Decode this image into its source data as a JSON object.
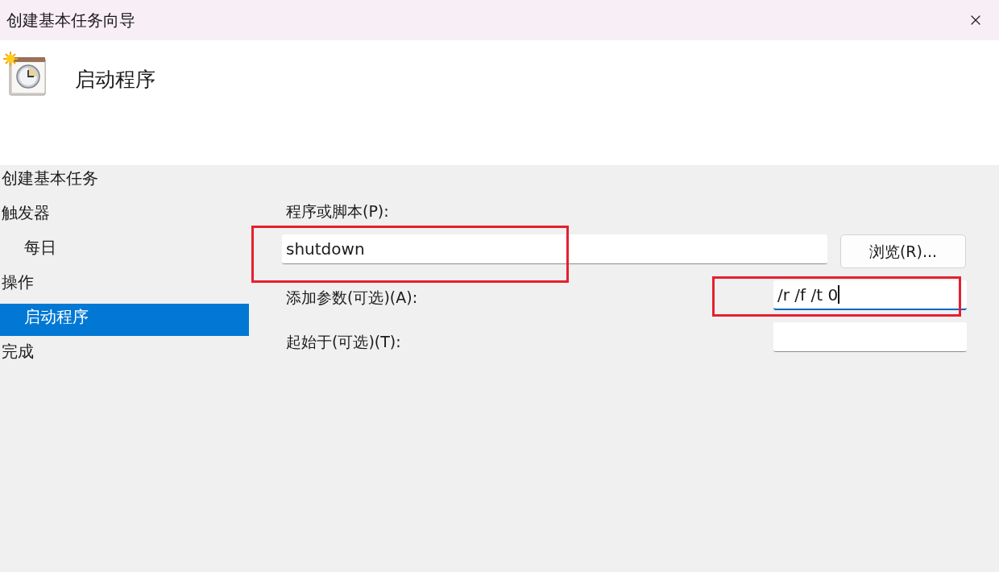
{
  "window": {
    "title": "创建基本任务向导"
  },
  "header": {
    "title": "启动程序"
  },
  "steps": [
    {
      "label": "创建基本任务",
      "selected": false
    },
    {
      "label": "触发器",
      "selected": false,
      "children": [
        {
          "label": "每日",
          "selected": false
        }
      ]
    },
    {
      "label": "操作",
      "selected": false,
      "children": [
        {
          "label": "启动程序",
          "selected": true
        }
      ]
    },
    {
      "label": "完成",
      "selected": false
    }
  ],
  "form": {
    "program": {
      "label": "程序或脚本(P):",
      "value": "shutdown",
      "focused": false,
      "highlighted": true
    },
    "browse_button": "浏览(R)...",
    "arguments": {
      "label": "添加参数(可选)(A):",
      "value": "/r /f /t 0",
      "focused": true,
      "highlighted": true
    },
    "start_in": {
      "label": "起始于(可选)(T):",
      "focused": false
    }
  }
}
